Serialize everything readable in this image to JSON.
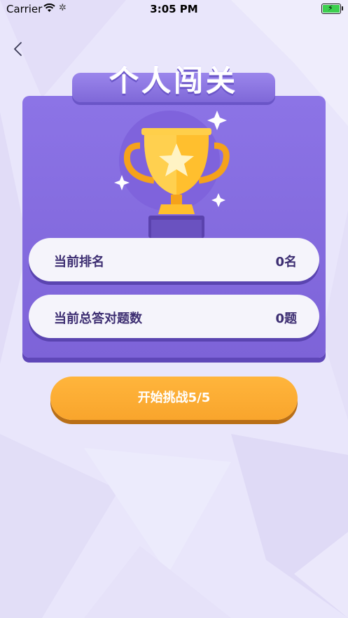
{
  "status_bar": {
    "carrier": "Carrier",
    "time": "3:05 PM"
  },
  "header": {
    "title": "个人闯关"
  },
  "stats": [
    {
      "label": "当前排名",
      "value": "0名"
    },
    {
      "label": "当前总答对题数",
      "value": "0题"
    }
  ],
  "actions": {
    "start_label": "开始挑战5/5"
  },
  "colors": {
    "background": "#e9e6fb",
    "card": "#8c74e6",
    "row": "#f5f4fb",
    "button": "#ffb53c",
    "text_dark": "#3d2e72"
  }
}
